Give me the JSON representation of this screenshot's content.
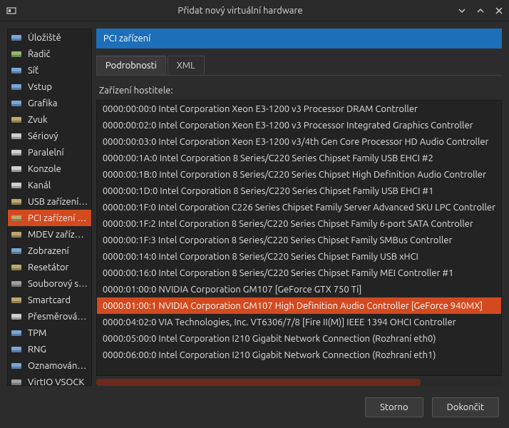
{
  "window": {
    "title": "Přidat nový virtuální hardware"
  },
  "sidebar": {
    "items": [
      {
        "label": "Úložiště",
        "icon": "disk",
        "color": "#7aa6d6"
      },
      {
        "label": "Řadič",
        "icon": "controller",
        "color": "#8fb96e"
      },
      {
        "label": "Síť",
        "icon": "network",
        "color": "#7aa6d6"
      },
      {
        "label": "Vstup",
        "icon": "input",
        "color": "#7aa6d6"
      },
      {
        "label": "Grafika",
        "icon": "display",
        "color": "#7aa6d6"
      },
      {
        "label": "Zvuk",
        "icon": "sound",
        "color": "#bda96e"
      },
      {
        "label": "Sériový",
        "icon": "serial",
        "color": "#cfcfcf"
      },
      {
        "label": "Paralelní",
        "icon": "parallel",
        "color": "#cfcfcf"
      },
      {
        "label": "Konzole",
        "icon": "console",
        "color": "#cfcfcf"
      },
      {
        "label": "Kanál",
        "icon": "channel",
        "color": "#cfcfcf"
      },
      {
        "label": "USB zařízení hostitele",
        "icon": "usb",
        "color": "#bda96e"
      },
      {
        "label": "PCI zařízení hostitele",
        "icon": "pci",
        "color": "#bda96e",
        "selected": true
      },
      {
        "label": "MDEV zařízení hostitele",
        "icon": "mdev",
        "color": "#bda96e"
      },
      {
        "label": "Zobrazení",
        "icon": "video",
        "color": "#7aa6d6"
      },
      {
        "label": "Resetátor",
        "icon": "watchdog",
        "color": "#bda96e"
      },
      {
        "label": "Souborový systém",
        "icon": "filesystem",
        "color": "#a0a0a0"
      },
      {
        "label": "Smartcard",
        "icon": "smartcard",
        "color": "#bda96e"
      },
      {
        "label": "Přesměrování USB",
        "icon": "usbredir",
        "color": "#cfcfcf"
      },
      {
        "label": "TPM",
        "icon": "tpm",
        "color": "#7aa6d6"
      },
      {
        "label": "RNG",
        "icon": "rng",
        "color": "#7aa6d6"
      },
      {
        "label": "Oznamování paniky",
        "icon": "panic",
        "color": "#7aa6d6"
      },
      {
        "label": "VirtIO VSOCK",
        "icon": "vsock",
        "color": "#a0a0a0"
      }
    ]
  },
  "content": {
    "title": "PCI zařízení",
    "tabs": [
      {
        "label": "Podrobnosti",
        "active": true
      },
      {
        "label": "XML"
      }
    ],
    "host_device_label": "Zařízení hostitele:",
    "devices": [
      "0000:00:00:0 Intel Corporation Xeon E3-1200 v3 Processor DRAM Controller",
      "0000:00:02:0 Intel Corporation Xeon E3-1200 v3 Processor Integrated Graphics Controller",
      "0000:00:03:0 Intel Corporation Xeon E3-1200 v3/4th Gen Core Processor HD Audio Controller",
      "0000:00:1A:0 Intel Corporation 8 Series/C220 Series Chipset Family USB EHCI #2",
      "0000:00:1B:0 Intel Corporation 8 Series/C220 Series Chipset High Definition Audio Controller",
      "0000:00:1D:0 Intel Corporation 8 Series/C220 Series Chipset Family USB EHCI #1",
      "0000:00:1F:0 Intel Corporation C226 Series Chipset Family Server Advanced SKU LPC Controller",
      "0000:00:1F:2 Intel Corporation 8 Series/C220 Series Chipset Family 6-port SATA Controller",
      "0000:00:1F:3 Intel Corporation 8 Series/C220 Series Chipset Family SMBus Controller",
      "0000:00:14:0 Intel Corporation 8 Series/C220 Series Chipset Family USB xHCI",
      "0000:00:16:0 Intel Corporation 8 Series/C220 Series Chipset Family MEI Controller #1",
      "0000:01:00:0 NVIDIA Corporation GM107 [GeForce GTX 750 Ti]",
      "0000:01:00:1 NVIDIA Corporation GM107 High Definition Audio Controller [GeForce 940MX]",
      "0000:04:02:0 VIA Technologies, Inc. VT6306/7/8 [Fire II(M)] IEEE 1394 OHCI Controller",
      "0000:05:00:0 Intel Corporation I210 Gigabit Network Connection (Rozhraní eth0)",
      "0000:06:00:0 Intel Corporation I210 Gigabit Network Connection (Rozhraní eth1)"
    ],
    "selected_device_index": 12
  },
  "buttons": {
    "cancel": "Storno",
    "finish": "Dokončit"
  }
}
